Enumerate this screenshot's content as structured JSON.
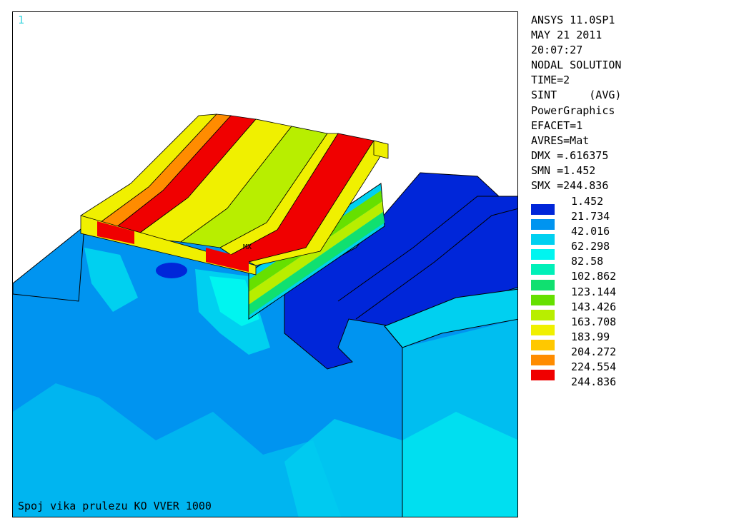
{
  "window": {
    "number": "1",
    "title": "Spoj vika prulezu KO VVER 1000"
  },
  "info": [
    "ANSYS 11.0SP1",
    "MAY 21 2011",
    "20:07:27",
    "NODAL SOLUTION",
    "TIME=2",
    "SINT     (AVG)",
    "PowerGraphics",
    "EFACET=1",
    "AVRES=Mat",
    "DMX =.616375",
    "SMN =1.452",
    "SMX =244.836"
  ],
  "legend": {
    "min_label": "1.452",
    "items": [
      {
        "value": "21.734",
        "color": "#0026d9"
      },
      {
        "value": "42.016",
        "color": "#0094f0"
      },
      {
        "value": "62.298",
        "color": "#00d0f0"
      },
      {
        "value": "82.58",
        "color": "#00f5f0"
      },
      {
        "value": "102.862",
        "color": "#00f0b8"
      },
      {
        "value": "123.144",
        "color": "#10e070"
      },
      {
        "value": "143.426",
        "color": "#66e000"
      },
      {
        "value": "163.708",
        "color": "#b8ee00"
      },
      {
        "value": "183.99",
        "color": "#f0f000"
      },
      {
        "value": "204.272",
        "color": "#ffc800"
      },
      {
        "value": "224.554",
        "color": "#ff8c00"
      },
      {
        "value": "244.836",
        "color": "#f00000"
      }
    ]
  },
  "model": {
    "marker_label": "MX"
  }
}
